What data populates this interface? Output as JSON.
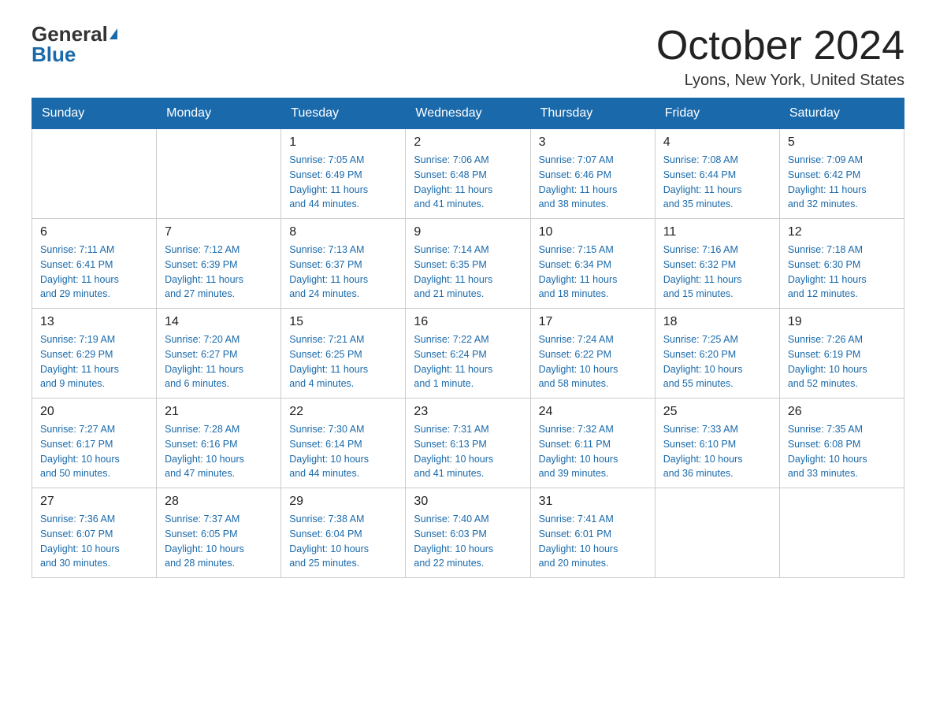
{
  "logo": {
    "general": "General",
    "blue": "Blue"
  },
  "title": "October 2024",
  "location": "Lyons, New York, United States",
  "days_header": [
    "Sunday",
    "Monday",
    "Tuesday",
    "Wednesday",
    "Thursday",
    "Friday",
    "Saturday"
  ],
  "weeks": [
    [
      {
        "day": "",
        "info": ""
      },
      {
        "day": "",
        "info": ""
      },
      {
        "day": "1",
        "info": "Sunrise: 7:05 AM\nSunset: 6:49 PM\nDaylight: 11 hours\nand 44 minutes."
      },
      {
        "day": "2",
        "info": "Sunrise: 7:06 AM\nSunset: 6:48 PM\nDaylight: 11 hours\nand 41 minutes."
      },
      {
        "day": "3",
        "info": "Sunrise: 7:07 AM\nSunset: 6:46 PM\nDaylight: 11 hours\nand 38 minutes."
      },
      {
        "day": "4",
        "info": "Sunrise: 7:08 AM\nSunset: 6:44 PM\nDaylight: 11 hours\nand 35 minutes."
      },
      {
        "day": "5",
        "info": "Sunrise: 7:09 AM\nSunset: 6:42 PM\nDaylight: 11 hours\nand 32 minutes."
      }
    ],
    [
      {
        "day": "6",
        "info": "Sunrise: 7:11 AM\nSunset: 6:41 PM\nDaylight: 11 hours\nand 29 minutes."
      },
      {
        "day": "7",
        "info": "Sunrise: 7:12 AM\nSunset: 6:39 PM\nDaylight: 11 hours\nand 27 minutes."
      },
      {
        "day": "8",
        "info": "Sunrise: 7:13 AM\nSunset: 6:37 PM\nDaylight: 11 hours\nand 24 minutes."
      },
      {
        "day": "9",
        "info": "Sunrise: 7:14 AM\nSunset: 6:35 PM\nDaylight: 11 hours\nand 21 minutes."
      },
      {
        "day": "10",
        "info": "Sunrise: 7:15 AM\nSunset: 6:34 PM\nDaylight: 11 hours\nand 18 minutes."
      },
      {
        "day": "11",
        "info": "Sunrise: 7:16 AM\nSunset: 6:32 PM\nDaylight: 11 hours\nand 15 minutes."
      },
      {
        "day": "12",
        "info": "Sunrise: 7:18 AM\nSunset: 6:30 PM\nDaylight: 11 hours\nand 12 minutes."
      }
    ],
    [
      {
        "day": "13",
        "info": "Sunrise: 7:19 AM\nSunset: 6:29 PM\nDaylight: 11 hours\nand 9 minutes."
      },
      {
        "day": "14",
        "info": "Sunrise: 7:20 AM\nSunset: 6:27 PM\nDaylight: 11 hours\nand 6 minutes."
      },
      {
        "day": "15",
        "info": "Sunrise: 7:21 AM\nSunset: 6:25 PM\nDaylight: 11 hours\nand 4 minutes."
      },
      {
        "day": "16",
        "info": "Sunrise: 7:22 AM\nSunset: 6:24 PM\nDaylight: 11 hours\nand 1 minute."
      },
      {
        "day": "17",
        "info": "Sunrise: 7:24 AM\nSunset: 6:22 PM\nDaylight: 10 hours\nand 58 minutes."
      },
      {
        "day": "18",
        "info": "Sunrise: 7:25 AM\nSunset: 6:20 PM\nDaylight: 10 hours\nand 55 minutes."
      },
      {
        "day": "19",
        "info": "Sunrise: 7:26 AM\nSunset: 6:19 PM\nDaylight: 10 hours\nand 52 minutes."
      }
    ],
    [
      {
        "day": "20",
        "info": "Sunrise: 7:27 AM\nSunset: 6:17 PM\nDaylight: 10 hours\nand 50 minutes."
      },
      {
        "day": "21",
        "info": "Sunrise: 7:28 AM\nSunset: 6:16 PM\nDaylight: 10 hours\nand 47 minutes."
      },
      {
        "day": "22",
        "info": "Sunrise: 7:30 AM\nSunset: 6:14 PM\nDaylight: 10 hours\nand 44 minutes."
      },
      {
        "day": "23",
        "info": "Sunrise: 7:31 AM\nSunset: 6:13 PM\nDaylight: 10 hours\nand 41 minutes."
      },
      {
        "day": "24",
        "info": "Sunrise: 7:32 AM\nSunset: 6:11 PM\nDaylight: 10 hours\nand 39 minutes."
      },
      {
        "day": "25",
        "info": "Sunrise: 7:33 AM\nSunset: 6:10 PM\nDaylight: 10 hours\nand 36 minutes."
      },
      {
        "day": "26",
        "info": "Sunrise: 7:35 AM\nSunset: 6:08 PM\nDaylight: 10 hours\nand 33 minutes."
      }
    ],
    [
      {
        "day": "27",
        "info": "Sunrise: 7:36 AM\nSunset: 6:07 PM\nDaylight: 10 hours\nand 30 minutes."
      },
      {
        "day": "28",
        "info": "Sunrise: 7:37 AM\nSunset: 6:05 PM\nDaylight: 10 hours\nand 28 minutes."
      },
      {
        "day": "29",
        "info": "Sunrise: 7:38 AM\nSunset: 6:04 PM\nDaylight: 10 hours\nand 25 minutes."
      },
      {
        "day": "30",
        "info": "Sunrise: 7:40 AM\nSunset: 6:03 PM\nDaylight: 10 hours\nand 22 minutes."
      },
      {
        "day": "31",
        "info": "Sunrise: 7:41 AM\nSunset: 6:01 PM\nDaylight: 10 hours\nand 20 minutes."
      },
      {
        "day": "",
        "info": ""
      },
      {
        "day": "",
        "info": ""
      }
    ]
  ]
}
